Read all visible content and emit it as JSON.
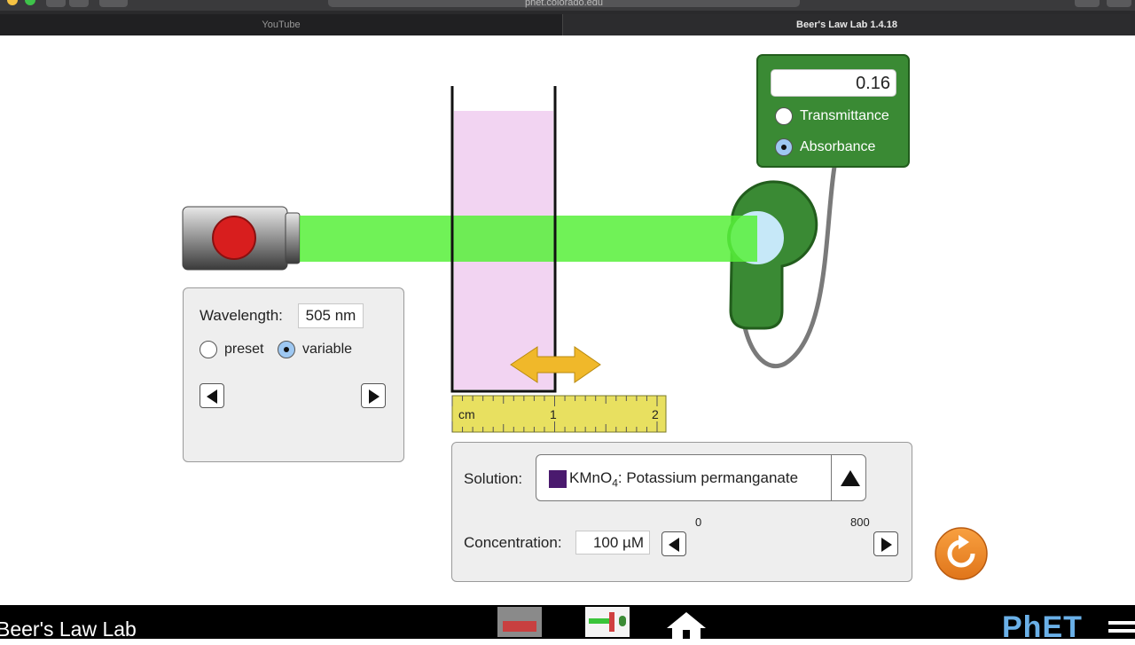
{
  "browser": {
    "url": "phet.colorado.edu",
    "tabs": [
      {
        "label": "YouTube"
      },
      {
        "label": "Beer's Law Lab 1.4.18"
      }
    ]
  },
  "meter": {
    "value": "0.16",
    "options": [
      {
        "label": "Transmittance",
        "selected": false
      },
      {
        "label": "Absorbance",
        "selected": true
      }
    ]
  },
  "light": {
    "wavelength_label": "Wavelength:",
    "wavelength_value": "505 nm",
    "modes": [
      {
        "label": "preset",
        "selected": false
      },
      {
        "label": "variable",
        "selected": true
      }
    ],
    "beam_color": "#57f03a"
  },
  "ruler": {
    "unit": "cm",
    "ticks": [
      "1",
      "2"
    ]
  },
  "solution": {
    "label": "Solution:",
    "formula_main": "KMnO",
    "formula_sub": "4",
    "name": ": Potassium permanganate",
    "swatch_color": "#4a1a6e",
    "concentration_label": "Concentration:",
    "concentration_value": "100 µM",
    "slider_min": "0",
    "slider_max": "800",
    "slider_value": 100
  },
  "app": {
    "title": "Beer's Law Lab",
    "logo": "PhET"
  }
}
